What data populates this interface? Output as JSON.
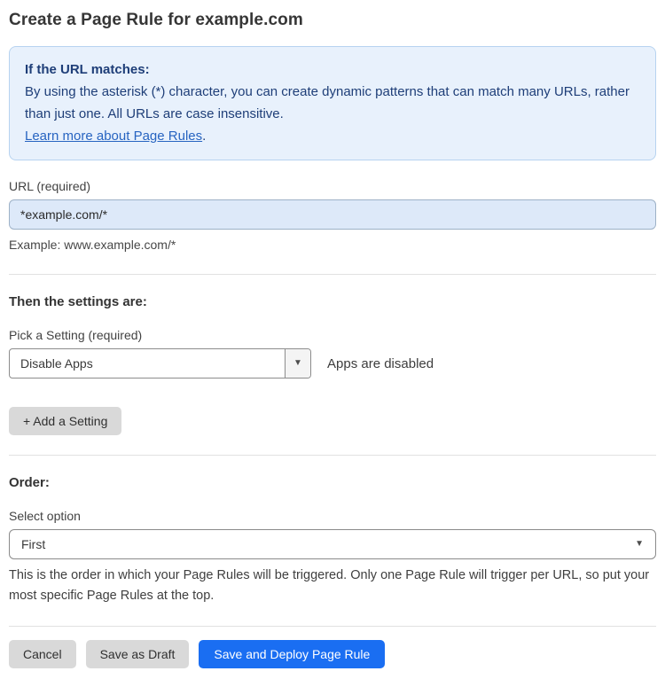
{
  "page": {
    "title": "Create a Page Rule for example.com"
  },
  "info_box": {
    "heading": "If the URL matches:",
    "body": "By using the asterisk (*) character, you can create dynamic patterns that can match many URLs, rather than just one. All URLs are case insensitive.",
    "link_label": "Learn more about Page Rules",
    "link_suffix": "."
  },
  "url_field": {
    "label": "URL (required)",
    "value": "*example.com/*",
    "helper": "Example: www.example.com/*"
  },
  "settings_section": {
    "heading": "Then the settings are:",
    "picker_label": "Pick a Setting (required)",
    "picker_value": "Disable Apps",
    "status_text": "Apps are disabled",
    "add_setting_label": "+ Add a Setting"
  },
  "order_section": {
    "heading": "Order:",
    "select_label": "Select option",
    "select_value": "First",
    "helper": "This is the order in which your Page Rules will be triggered. Only one Page Rule will trigger per URL, so put your most specific Page Rules at the top."
  },
  "footer": {
    "cancel_label": "Cancel",
    "save_draft_label": "Save as Draft",
    "save_deploy_label": "Save and Deploy Page Rule"
  },
  "icons": {
    "caret_down": "▼"
  },
  "colors": {
    "accent_blue": "#1a6ef2",
    "info_bg": "#e8f1fc",
    "info_border": "#b7d3f0",
    "info_text": "#1e3e78",
    "link_blue": "#2764c1",
    "input_bg": "#dde9f9",
    "button_gray": "#d9d9d9"
  }
}
